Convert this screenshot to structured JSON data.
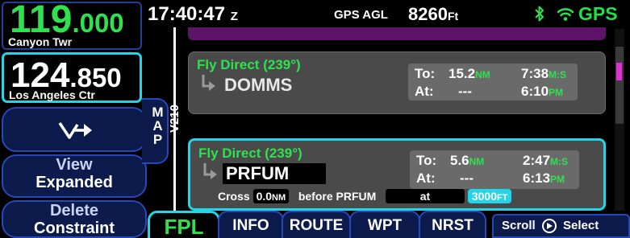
{
  "status_bar": {
    "time": "17:40:47",
    "time_zone": "Z",
    "agl_label": "GPS AGL",
    "agl_value": "8260",
    "agl_unit": "Ft",
    "gps_label": "GPS"
  },
  "radio": {
    "active": {
      "freq_main": "119",
      "freq_decimal": ".000",
      "name": "Canyon Twr"
    },
    "standby": {
      "freq_main": "124",
      "freq_decimal": ".850",
      "name": "Los Angeles Ctr"
    }
  },
  "softkeys": {
    "view_line1": "View",
    "view_line2": "Expanded",
    "delete_line1": "Delete",
    "delete_line2": "Constraint"
  },
  "map_tab": {
    "label": "MAP"
  },
  "route": {
    "airway": "V210"
  },
  "legs": [
    {
      "title": "Fly Direct (239°)",
      "waypoint": "DOMMS",
      "to_label": "To:",
      "to_dist": "15.2",
      "to_dist_unit": "NM",
      "to_time": "7:38",
      "to_time_unit": "M:S",
      "at_label": "At:",
      "at_value": "---",
      "at_time": "6:10",
      "at_time_unit": "PM"
    },
    {
      "title": "Fly Direct (239°)",
      "waypoint": "PRFUM",
      "to_label": "To:",
      "to_dist": "5.6",
      "to_dist_unit": "NM",
      "to_time": "2:47",
      "to_time_unit": "M:S",
      "at_label": "At:",
      "at_value": "---",
      "at_time": "6:13",
      "at_time_unit": "PM",
      "cross_label": "Cross",
      "cross_dist": "0.0",
      "cross_dist_unit": "NM",
      "cross_before": "before PRFUM",
      "cross_at": "at",
      "cross_alt": "3000",
      "cross_alt_unit": "FT"
    }
  ],
  "tabs": [
    {
      "label": "FPL",
      "active": true
    },
    {
      "label": "INFO"
    },
    {
      "label": "ROUTE"
    },
    {
      "label": "WPT"
    },
    {
      "label": "NRST"
    }
  ],
  "scroll_select": {
    "scroll": "Scroll",
    "select": "Select"
  },
  "colors": {
    "accent_green": "#2ee24e",
    "accent_cyan": "#22d5e8",
    "softkey_blue": "#0c1a4c",
    "active_leg_marker": "#e02ed8",
    "previous_leg": "#5c1466"
  },
  "icons": [
    "bluetooth-icon",
    "wifi-icon",
    "vector-to-icon",
    "leg-arrow-icon",
    "knob-icon"
  ]
}
